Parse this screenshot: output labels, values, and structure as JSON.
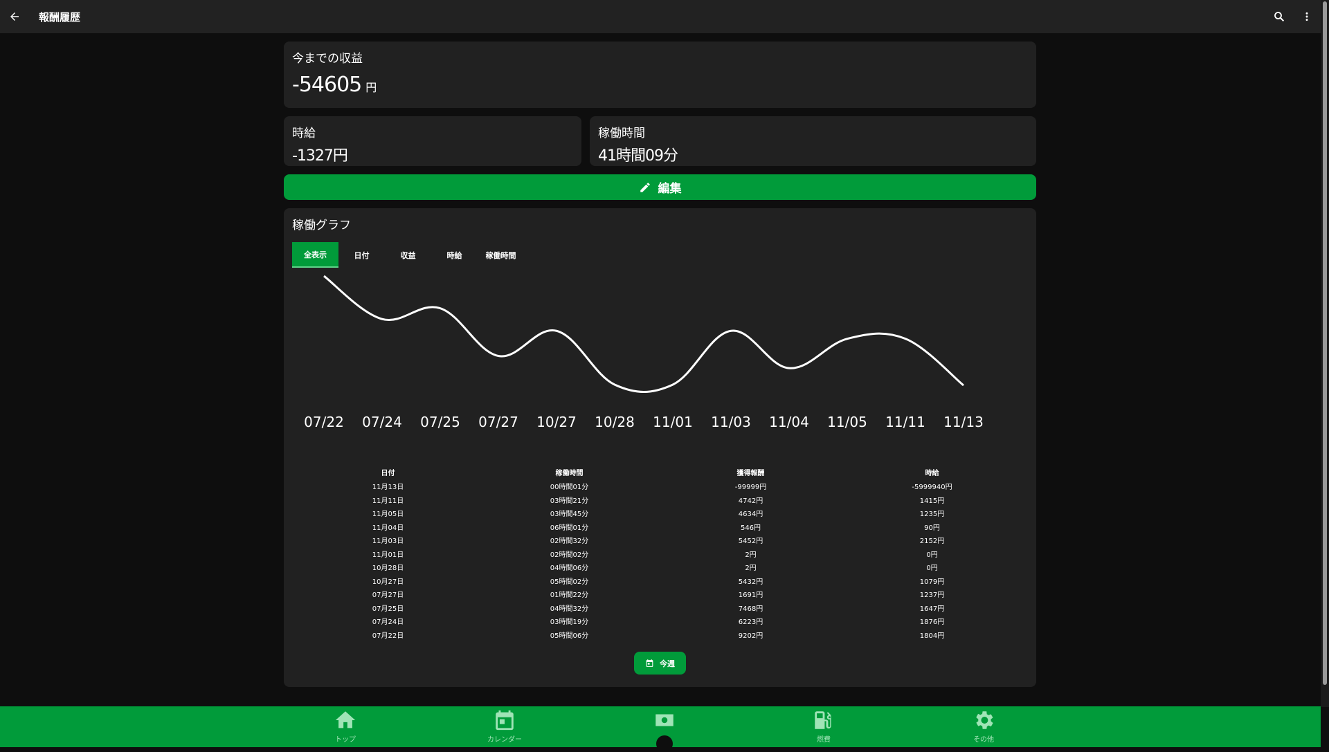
{
  "appbar": {
    "title": "報酬履歴",
    "back_icon": "arrow-back-icon",
    "search_icon": "search-icon",
    "menu_icon": "more-vert-icon"
  },
  "summary": {
    "total_label": "今までの収益",
    "total_value": "-54605",
    "total_unit": "円",
    "hourly_label": "時給",
    "hourly_value": "-1327円",
    "worktime_label": "稼働時間",
    "worktime_value": "41時間09分"
  },
  "edit_button": {
    "label": "編集",
    "icon": "pencil-icon"
  },
  "graph": {
    "label": "稼働グラフ",
    "tabs": [
      "全表示",
      "日付",
      "収益",
      "時給",
      "稼働時間"
    ],
    "active_tab": "全表示"
  },
  "chart_data": {
    "type": "line",
    "categories": [
      "07/22",
      "07/24",
      "07/25",
      "07/27",
      "10/27",
      "10/28",
      "11/01",
      "11/03",
      "11/04",
      "11/05",
      "11/11",
      "11/13"
    ],
    "values": [
      305,
      185,
      215,
      82,
      152,
      2,
      2,
      152,
      48,
      130,
      130,
      0
    ],
    "grid": false,
    "color": "#ffffff"
  },
  "table": {
    "headers": [
      "日付",
      "稼働時間",
      "獲得報酬",
      "時給"
    ],
    "rows": [
      [
        "11月13日",
        "00時間01分",
        "-99999円",
        "-5999940円"
      ],
      [
        "11月11日",
        "03時間21分",
        "4742円",
        "1415円"
      ],
      [
        "11月05日",
        "03時間45分",
        "4634円",
        "1235円"
      ],
      [
        "11月04日",
        "06時間01分",
        "546円",
        "90円"
      ],
      [
        "11月03日",
        "02時間32分",
        "5452円",
        "2152円"
      ],
      [
        "11月01日",
        "02時間02分",
        "2円",
        "0円"
      ],
      [
        "10月28日",
        "04時間06分",
        "2円",
        "0円"
      ],
      [
        "10月27日",
        "05時間02分",
        "5432円",
        "1079円"
      ],
      [
        "07月27日",
        "01時間22分",
        "1691円",
        "1237円"
      ],
      [
        "07月25日",
        "04時間32分",
        "7468円",
        "1647円"
      ],
      [
        "07月24日",
        "03時間19分",
        "6223円",
        "1876円"
      ],
      [
        "07月22日",
        "05時間06分",
        "9202円",
        "1804円"
      ]
    ]
  },
  "week_button": {
    "label": "今週",
    "icon": "calendar-icon"
  },
  "bottom_nav": {
    "items": [
      {
        "label": "トップ",
        "icon": "home-icon"
      },
      {
        "label": "カレンダー",
        "icon": "calendar-icon"
      },
      {
        "label": "",
        "icon": "money-icon"
      },
      {
        "label": "燃費",
        "icon": "gas-station-icon"
      },
      {
        "label": "その他",
        "icon": "settings-icon"
      }
    ]
  },
  "colors": {
    "accent": "#019b3a",
    "card": "#212121",
    "background": "#0e0e0e"
  }
}
